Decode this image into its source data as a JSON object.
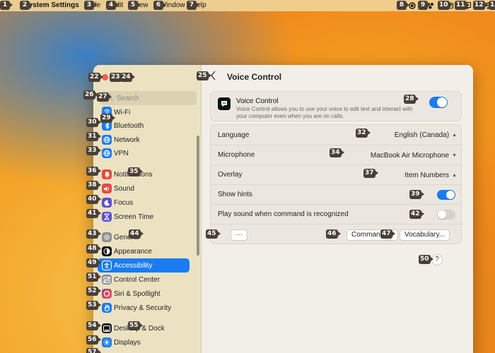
{
  "menubar": {
    "apple_icon": "apple-logo",
    "app_name": "System Settings",
    "menus": [
      "File",
      "Edit",
      "View",
      "Window",
      "Help"
    ],
    "tray_icons": [
      "record-icon",
      "control-center-icon",
      "battery-icon",
      "screen-mirroring-icon",
      "wifi-icon"
    ]
  },
  "badges": [
    "1",
    "2",
    "3",
    "4",
    "5",
    "6",
    "7",
    "8",
    "9",
    "10",
    "11",
    "12",
    "13",
    "22",
    "23",
    "24",
    "25",
    "26",
    "27",
    "28",
    "29",
    "30",
    "31",
    "32",
    "33",
    "34",
    "35",
    "36",
    "37",
    "38",
    "39",
    "40",
    "41",
    "42",
    "43",
    "44",
    "45",
    "46",
    "47",
    "48",
    "49",
    "50",
    "51",
    "52",
    "53",
    "54",
    "55",
    "56",
    "57"
  ],
  "window": {
    "search_placeholder": "Search",
    "sidebar_items": [
      {
        "label": "Wi-Fi",
        "icon": "wifi-icon",
        "color": "#1a7cf0"
      },
      {
        "label": "Bluetooth",
        "icon": "bluetooth-icon",
        "color": "#1a7cf0"
      },
      {
        "label": "Network",
        "icon": "globe-icon",
        "color": "#1a7cf0"
      },
      {
        "label": "VPN",
        "icon": "globe-icon",
        "color": "#1a7cf0"
      },
      {
        "label": "Notifications",
        "icon": "bell-icon",
        "color": "#e8483f"
      },
      {
        "label": "Sound",
        "icon": "speaker-icon",
        "color": "#e8483f"
      },
      {
        "label": "Focus",
        "icon": "moon-icon",
        "color": "#5b4fd1"
      },
      {
        "label": "Screen Time",
        "icon": "hourglass-icon",
        "color": "#5b4fd1"
      },
      {
        "label": "General",
        "icon": "gear-icon",
        "color": "#8e8e93"
      },
      {
        "label": "Appearance",
        "icon": "appearance-icon",
        "color": "#111111"
      },
      {
        "label": "Accessibility",
        "icon": "accessibility-icon",
        "color": "#1a7cf0"
      },
      {
        "label": "Control Center",
        "icon": "control-center-icon",
        "color": "#8e8e93"
      },
      {
        "label": "Siri & Spotlight",
        "icon": "siri-icon",
        "color": "#c14fd8"
      },
      {
        "label": "Privacy & Security",
        "icon": "hand-icon",
        "color": "#1a7cf0"
      },
      {
        "label": "Desktop & Dock",
        "icon": "dock-icon",
        "color": "#111111"
      },
      {
        "label": "Displays",
        "icon": "sun-icon",
        "color": "#1a7cf0"
      }
    ],
    "selected_item": "Accessibility",
    "title": "Voice Control",
    "voice_control": {
      "title": "Voice Control",
      "description": "Voice Control allows you to use your voice to edit text and interact with your computer even when you are on calls.",
      "enabled": true
    },
    "settings": {
      "language_label": "Language",
      "language_value": "English (Canada)",
      "microphone_label": "Microphone",
      "microphone_value": "MacBook Air Microphone",
      "overlay_label": "Overlay",
      "overlay_value": "Item Numbers",
      "show_hints_label": "Show hints",
      "show_hints_enabled": true,
      "play_sound_label": "Play sound when command is recognized",
      "play_sound_enabled": false
    },
    "buttons": {
      "more": "···",
      "commands": "Commands...",
      "vocabulary": "Vocabulary...",
      "help": "?"
    }
  }
}
